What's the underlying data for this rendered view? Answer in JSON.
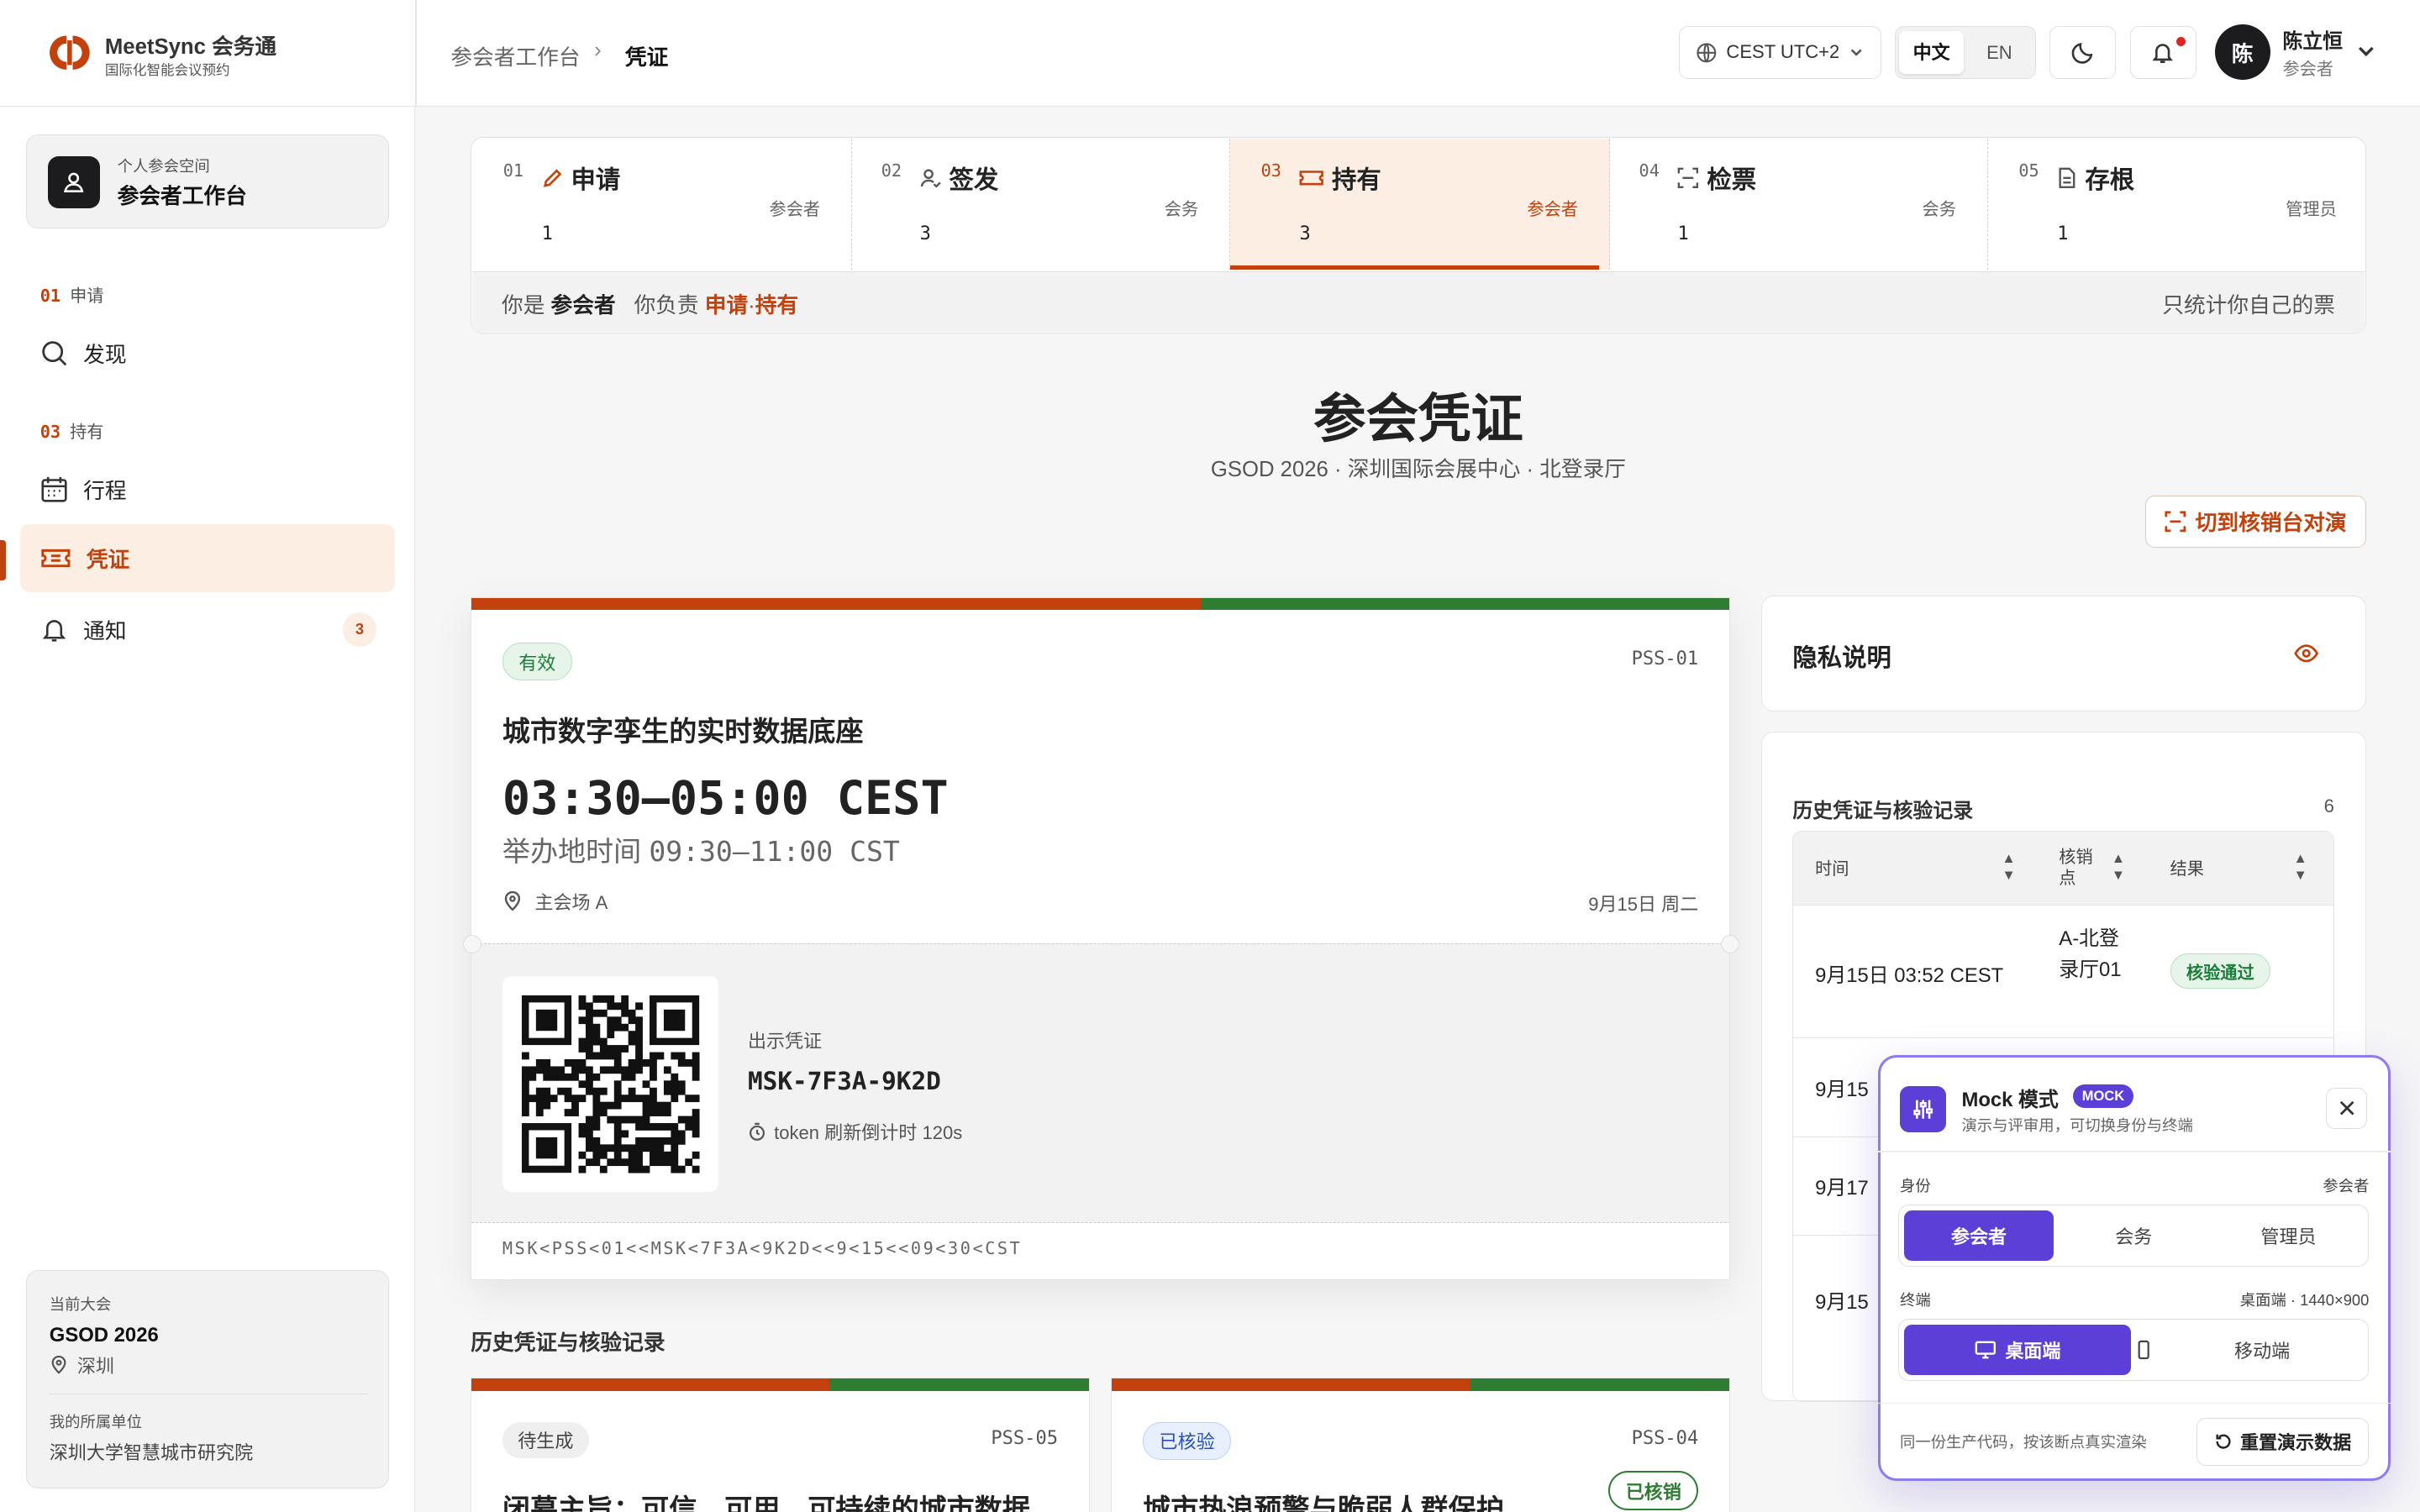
{
  "brand": {
    "name": "MeetSync 会务通",
    "subtitle": "国际化智能会议预约"
  },
  "breadcrumb": {
    "parent": "参会者工作台",
    "sep": "›",
    "current": "凭证"
  },
  "topbar": {
    "timezone": "CEST UTC+2",
    "lang_zh": "中文",
    "lang_en": "EN",
    "user_initial": "陈",
    "user_name": "陈立恒",
    "user_role": "参会者"
  },
  "sidebar": {
    "workspace_sub": "个人参会空间",
    "workspace_title": "参会者工作台",
    "group1_num": "01",
    "group1_label": "申请",
    "discover": "发现",
    "group3_num": "03",
    "group3_label": "持有",
    "itinerary": "行程",
    "pass": "凭证",
    "notify": "通知",
    "notify_count": "3",
    "conf_label": "当前大会",
    "conf_name": "GSOD 2026",
    "conf_city": "深圳",
    "org_label": "我的所属单位",
    "org_name": "深圳大学智慧城市研究院"
  },
  "steps": [
    {
      "num": "01",
      "label": "申请",
      "role": "参会者",
      "count": "1"
    },
    {
      "num": "02",
      "label": "签发",
      "role": "会务",
      "count": "3"
    },
    {
      "num": "03",
      "label": "持有",
      "role": "参会者",
      "count": "3"
    },
    {
      "num": "04",
      "label": "检票",
      "role": "会务",
      "count": "1"
    },
    {
      "num": "05",
      "label": "存根",
      "role": "管理员",
      "count": "1"
    }
  ],
  "stepfoot": {
    "you_are": "你是",
    "role": "参会者",
    "responsible": "你负责",
    "duty1": "申请",
    "dot": "·",
    "duty2": "持有",
    "right": "只统计你自己的票"
  },
  "page": {
    "title": "参会凭证",
    "subtitle": "GSOD 2026 · 深圳国际会展中心 · 北登录厅",
    "switch_btn": "切到核销台对演"
  },
  "ticket": {
    "status": "有效",
    "id": "PSS-01",
    "title": "城市数字孪生的实时数据底座",
    "time": "03:30–05:00 CEST",
    "host_label": "举办地时间",
    "host_time": "09:30–11:00 CST",
    "venue": "主会场 A",
    "date": "9月15日 周二",
    "show_label": "出示凭证",
    "code": "MSK-7F3A-9K2D",
    "refresh": "token 刷新倒计时 120s",
    "mrz": "MSK<PSS<01<<MSK<7F3A<9K2D<<9<15<<09<30<CST"
  },
  "history_title": "历史凭证与核验记录",
  "cards": [
    {
      "status": "待生成",
      "id": "PSS-05",
      "title": "闭幕主旨：可信、可用、可持续的城市数据"
    },
    {
      "status": "已核验",
      "id": "PSS-04",
      "title": "城市热浪预警与脆弱人群保护",
      "stamp": "已核销"
    }
  ],
  "privacy": {
    "title": "隐私说明"
  },
  "history": {
    "title": "历史凭证与核验记录",
    "count": "6",
    "col_time": "时间",
    "col_point": "核销点",
    "col_result": "结果",
    "rows": [
      {
        "time": "9月15日 03:52 CEST",
        "point": "A-北登录厅01",
        "result": "核验通过"
      },
      {
        "time": "9月15"
      },
      {
        "time": "9月17"
      },
      {
        "time": "9月15"
      }
    ]
  },
  "mock": {
    "title": "Mock 模式",
    "badge": "MOCK",
    "sub": "演示与评审用，可切换身份与终端",
    "identity_label": "身份",
    "identity_value": "参会者",
    "id_options": [
      "参会者",
      "会务",
      "管理员"
    ],
    "terminal_label": "终端",
    "terminal_value": "桌面端 · 1440×900",
    "term_options": [
      "桌面端",
      "移动端"
    ],
    "footer": "同一份生产代码，按该断点真实渲染",
    "reset": "重置演示数据"
  },
  "colors": {
    "accent": "#c2410c",
    "accent_soft": "#fdeee3",
    "success": "#2e7d32",
    "mock": "#5b3fd6"
  }
}
